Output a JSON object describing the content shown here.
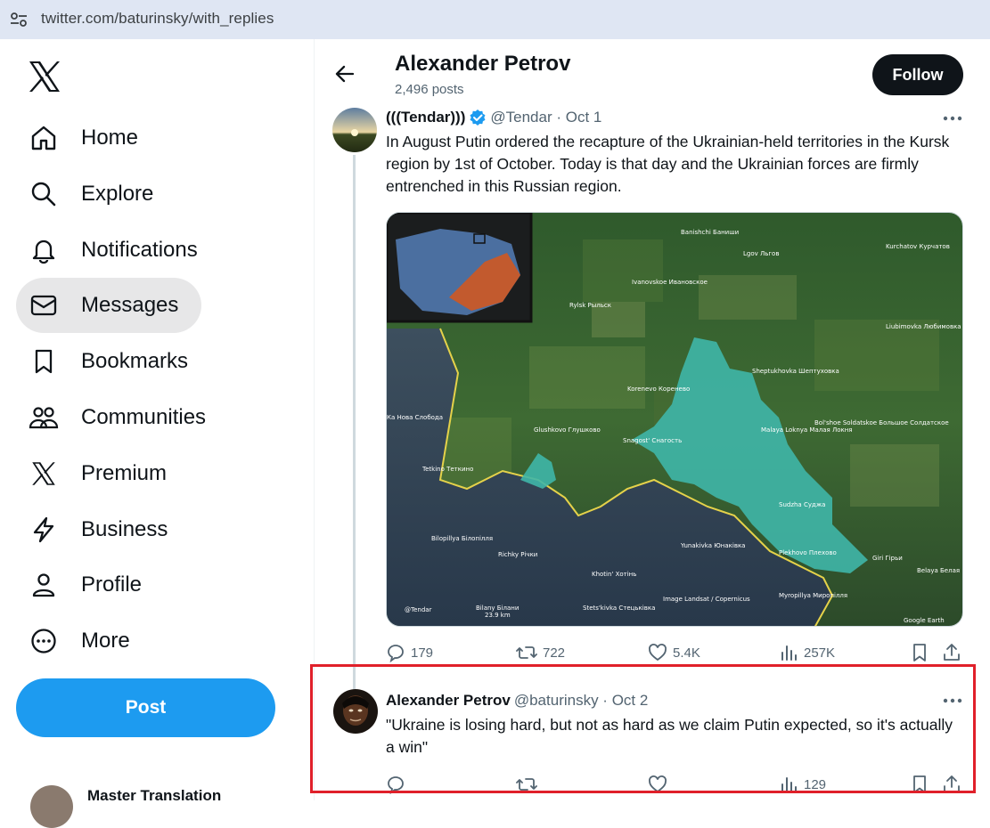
{
  "browser": {
    "url": "twitter.com/baturinsky/with_replies",
    "tune_icon": "tune-icon"
  },
  "sidebar": {
    "logo": "x-logo",
    "items": [
      {
        "label": "Home",
        "icon": "home-icon"
      },
      {
        "label": "Explore",
        "icon": "search-icon"
      },
      {
        "label": "Notifications",
        "icon": "bell-icon"
      },
      {
        "label": "Messages",
        "icon": "mail-icon",
        "active": true
      },
      {
        "label": "Bookmarks",
        "icon": "bookmark-icon"
      },
      {
        "label": "Communities",
        "icon": "communities-icon"
      },
      {
        "label": "Premium",
        "icon": "x-icon"
      },
      {
        "label": "Business",
        "icon": "lightning-icon"
      },
      {
        "label": "Profile",
        "icon": "person-icon"
      },
      {
        "label": "More",
        "icon": "more-circle-icon"
      }
    ],
    "post_label": "Post",
    "account_name": "Master Translation"
  },
  "header": {
    "name": "Alexander Petrov",
    "posts": "2,496 posts",
    "follow_label": "Follow"
  },
  "tweets": [
    {
      "name": "(((Tendar)))",
      "verified": true,
      "handle": "@Tendar · Oct 1",
      "text": "In August Putin ordered the recapture of the Ukrainian-held territories in the Kursk region by 1st of October. Today is that day and the Ukrainian forces are firmly entrenched in this Russian region.",
      "stats": {
        "replies": "179",
        "reposts": "722",
        "likes": "5.4K",
        "views": "257K"
      },
      "map_labels": [
        "Banishchi Баниши",
        "Kurchatov Курчатов",
        "Lgov Льгов",
        "Ivanovskoe Ивановское",
        "Rylsk Рыльск",
        "Liubimovka Любимовка",
        "Sheptukhovka Шептуховка",
        "Korenevo Коренево",
        "Bol'shoe Soldatskoe Большое Солдатское",
        "Glushkovo Глушково",
        "Snagost' Снагость",
        "Malaya Loknya Малая Локня",
        "Tetkino Теткино",
        "Sudzha Суджа",
        "Bilopillya Білопілля",
        "Richky Річки",
        "Yunakivka Юнаківка",
        "Plekhovo Плехово",
        "Giri Гiрьи",
        "Belaya Белая",
        "Khotin' Хотінь",
        "Image Landsat / Copernicus",
        "Myropillya Миропілля",
        "Bilany Білани",
        "23.9 km",
        "Stets'kivka Стецьківка",
        "Google Earth",
        "@Tendar",
        "Ка Нова Слобода"
      ]
    },
    {
      "name": "Alexander Petrov",
      "handle": "@baturinsky · Oct 2",
      "text": "\"Ukraine is losing hard, but not as hard as we claim Putin expected, so it's actually a win\"",
      "stats": {
        "views": "129"
      }
    }
  ],
  "colors": {
    "accent": "#1d9bf0",
    "highlight_box": "#e0202a"
  }
}
